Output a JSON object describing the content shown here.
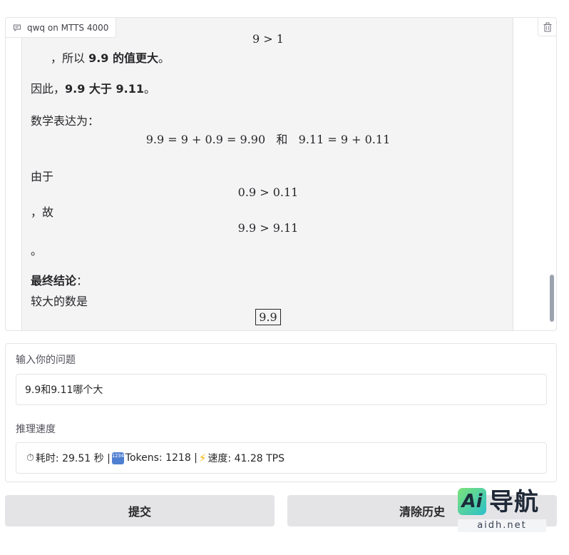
{
  "chatbot": {
    "label": "qwq on MTTS 4000",
    "math_top": "9 > 1",
    "line_1_prefix": "，所以 ",
    "line_1_bold": "9.9 的值更大",
    "line_1_suffix": "。",
    "line_2_prefix": "因此，",
    "line_2_bold": "9.9 大于 9.11",
    "line_2_suffix": "。",
    "line_3": "数学表达为：",
    "math_2": "9.9 = 9 + 0.9 = 9.90   和   9.11 = 9 + 0.11",
    "line_4": "由于",
    "math_3": "0.9 > 0.11",
    "line_5": "，故",
    "math_4": "9.9 > 9.11",
    "line_6": "。",
    "line_7_bold": "最终结论",
    "line_7_suffix": "：",
    "line_8": "较大的数是",
    "math_5": "9.9"
  },
  "form": {
    "question_label": "输入你的问题",
    "question_value": "9.9和9.11哪个大",
    "speed_label": "推理速度",
    "speed_time": "耗时: 29.51 秒 | ",
    "speed_tokens": "Tokens: 1218 | ",
    "speed_rate": "速度: 41.28 TPS",
    "numbox_text": "1234"
  },
  "buttons": {
    "submit": "提交",
    "clear": "清除历史"
  },
  "watermark": {
    "badge": "Ai",
    "text": "导航",
    "url": "aidh.net"
  },
  "icons": {
    "chat": "chat-bubble-icon",
    "trash": "trash-icon",
    "stopwatch": "stopwatch-icon",
    "numbers": "input-numbers-icon",
    "bolt": "lightning-icon"
  }
}
